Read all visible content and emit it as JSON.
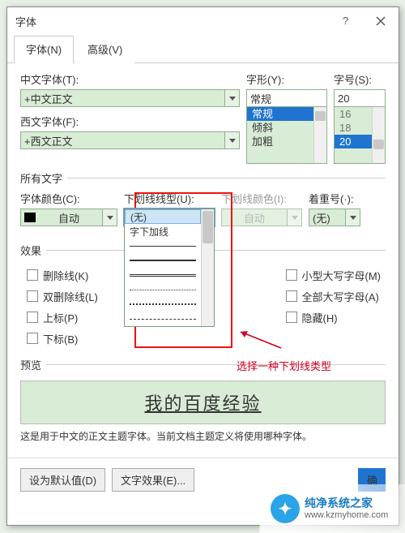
{
  "dialog": {
    "title": "字体",
    "tabs": {
      "font": "字体(N)",
      "advanced": "高级(V)"
    }
  },
  "chinese_font": {
    "label": "中文字体(T):",
    "value": "+中文正文"
  },
  "western_font": {
    "label": "西文字体(F):",
    "value": "+西文正文"
  },
  "style": {
    "label": "字形(Y):",
    "value": "常规",
    "options": {
      "o1": "常规",
      "o2": "倾斜",
      "o3": "加粗"
    }
  },
  "size": {
    "label": "字号(S):",
    "value": "20",
    "options": {
      "o1": "16",
      "o2": "18",
      "o3": "20"
    }
  },
  "all_text": "所有文字",
  "font_color": {
    "label": "字体颜色(C):",
    "value": "自动"
  },
  "underline_style": {
    "label": "下划线线型(U):",
    "value": "(无)",
    "popup": {
      "none": "(无)",
      "words_only": "字下加线"
    }
  },
  "underline_color": {
    "label": "下划线颜色(I):",
    "value": "自动"
  },
  "emphasis": {
    "label": "着重号(·):",
    "value": "(无)"
  },
  "effects": {
    "legend": "效果",
    "strike": "删除线(K)",
    "dstrike": "双删除线(L)",
    "superscript": "上标(P)",
    "subscript": "下标(B)",
    "smallcaps": "小型大写字母(M)",
    "allcaps": "全部大写字母(A)",
    "hidden": "隐藏(H)"
  },
  "preview": {
    "legend": "预览",
    "sample": "我的百度经验",
    "desc": "这是用于中文的正文主题字体。当前文档主题定义将使用哪种字体。"
  },
  "buttons": {
    "default": "设为默认值(D)",
    "text_effects": "文字效果(E)...",
    "ok": "确"
  },
  "annotation": {
    "text": "选择一种下划线类型"
  },
  "watermark": {
    "name": "纯净系统之家",
    "url": "www.kzmyhome.com"
  }
}
